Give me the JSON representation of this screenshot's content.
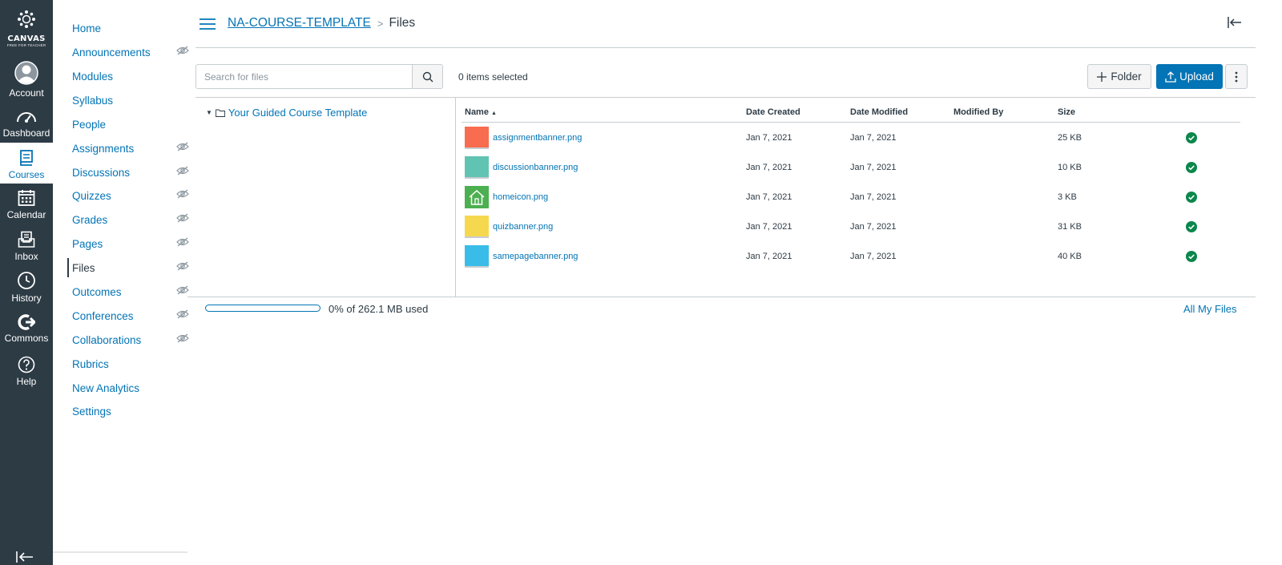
{
  "global_nav": {
    "logo_word": "CANVAS",
    "logo_tag": "FREE FOR TEACHER",
    "items": [
      {
        "label": "Account",
        "icon": "avatar-icon",
        "active": false
      },
      {
        "label": "Dashboard",
        "icon": "dashboard-icon",
        "active": false
      },
      {
        "label": "Courses",
        "icon": "courses-icon",
        "active": true
      },
      {
        "label": "Calendar",
        "icon": "calendar-icon",
        "active": false
      },
      {
        "label": "Inbox",
        "icon": "inbox-icon",
        "active": false
      },
      {
        "label": "History",
        "icon": "history-icon",
        "active": false
      },
      {
        "label": "Commons",
        "icon": "commons-icon",
        "active": false
      },
      {
        "label": "Help",
        "icon": "help-icon",
        "active": false
      }
    ]
  },
  "course_nav": {
    "items": [
      {
        "label": "Home",
        "hidden": false
      },
      {
        "label": "Announcements",
        "hidden": true
      },
      {
        "label": "Modules",
        "hidden": false
      },
      {
        "label": "Syllabus",
        "hidden": false
      },
      {
        "label": "People",
        "hidden": false
      },
      {
        "label": "Assignments",
        "hidden": true
      },
      {
        "label": "Discussions",
        "hidden": true
      },
      {
        "label": "Quizzes",
        "hidden": true
      },
      {
        "label": "Grades",
        "hidden": true
      },
      {
        "label": "Pages",
        "hidden": true
      },
      {
        "label": "Files",
        "hidden": true,
        "active": true
      },
      {
        "label": "Outcomes",
        "hidden": true
      },
      {
        "label": "Conferences",
        "hidden": true
      },
      {
        "label": "Collaborations",
        "hidden": true
      },
      {
        "label": "Rubrics",
        "hidden": false
      },
      {
        "label": "New Analytics",
        "hidden": false
      },
      {
        "label": "Settings",
        "hidden": false
      }
    ]
  },
  "header": {
    "breadcrumb_course": "NA-COURSE-TEMPLATE",
    "breadcrumb_separator": ">",
    "breadcrumb_current": "Files"
  },
  "toolbar": {
    "search_placeholder": "Search for files",
    "selected_count": "0 items selected",
    "folder_label": "Folder",
    "upload_label": "Upload"
  },
  "tree": {
    "root_label": "Your Guided Course Template"
  },
  "table": {
    "columns": {
      "name": "Name",
      "created": "Date Created",
      "modified": "Date Modified",
      "modified_by": "Modified By",
      "size": "Size"
    },
    "rows": [
      {
        "name": "assignmentbanner.png",
        "created": "Jan 7, 2021",
        "modified": "Jan 7, 2021",
        "modified_by": "",
        "size": "25 KB",
        "thumb_color": "#f86c4f"
      },
      {
        "name": "discussionbanner.png",
        "created": "Jan 7, 2021",
        "modified": "Jan 7, 2021",
        "modified_by": "",
        "size": "10 KB",
        "thumb_color": "#61c3b2"
      },
      {
        "name": "homeicon.png",
        "created": "Jan 7, 2021",
        "modified": "Jan 7, 2021",
        "modified_by": "",
        "size": "3 KB",
        "thumb_color": "#4caf50"
      },
      {
        "name": "quizbanner.png",
        "created": "Jan 7, 2021",
        "modified": "Jan 7, 2021",
        "modified_by": "",
        "size": "31 KB",
        "thumb_color": "#f6d84f"
      },
      {
        "name": "samepagebanner.png",
        "created": "Jan 7, 2021",
        "modified": "Jan 7, 2021",
        "modified_by": "",
        "size": "40 KB",
        "thumb_color": "#39bde8"
      }
    ]
  },
  "footer": {
    "quota_text": "0% of 262.1 MB used",
    "quota_percent": 0,
    "all_files_label": "All My Files"
  },
  "colors": {
    "nav_bg": "#2d3b45",
    "link": "#0374b5",
    "published": "#0b874b"
  }
}
